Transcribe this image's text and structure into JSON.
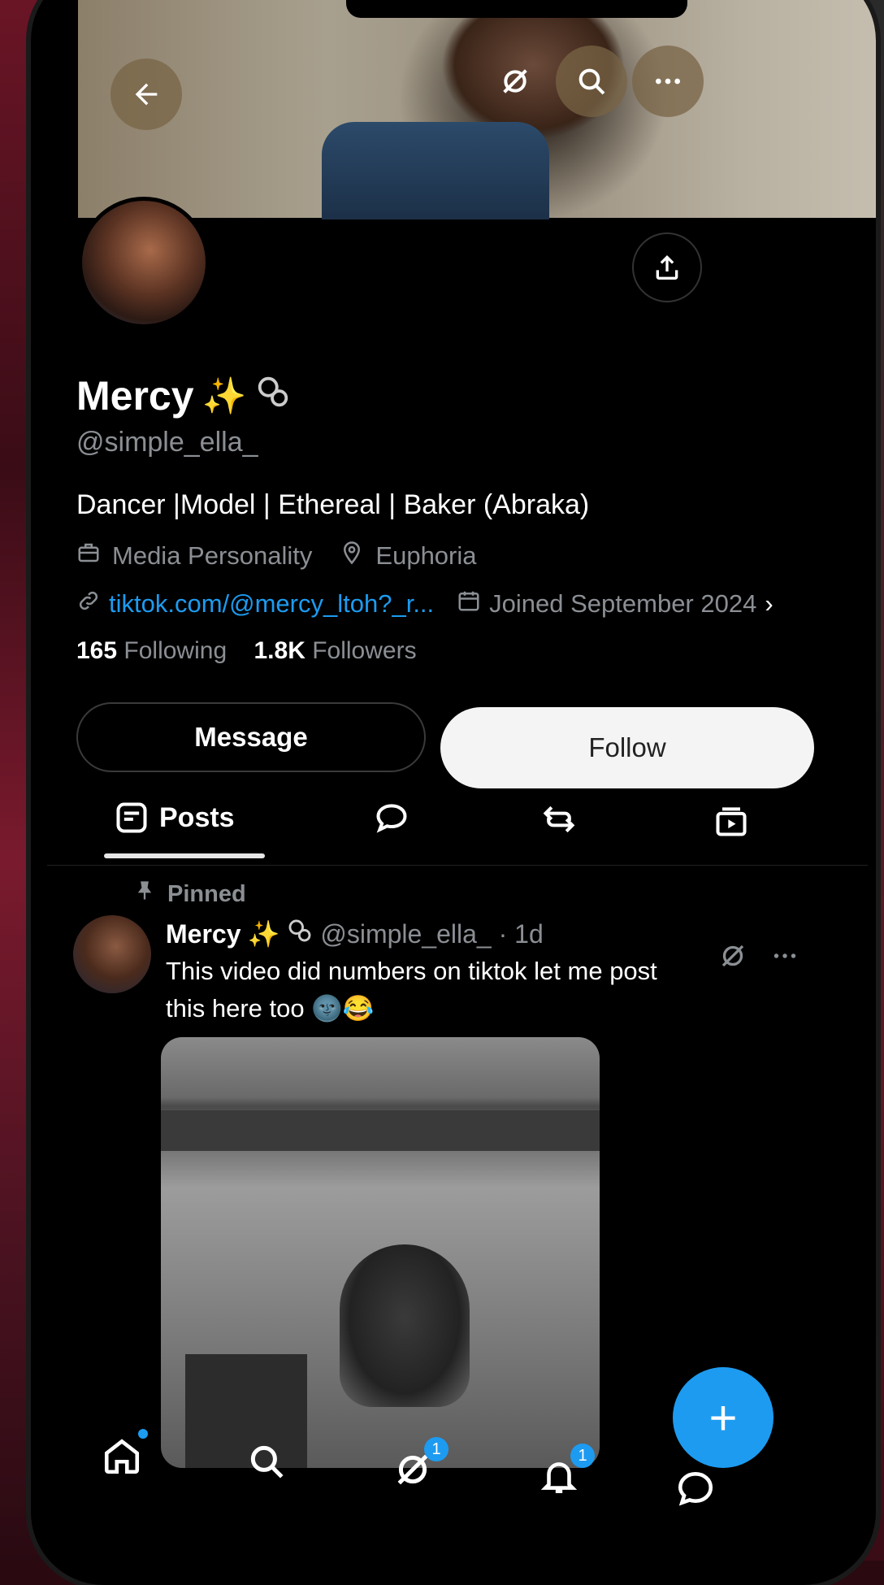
{
  "profile": {
    "display_name": "Mercy",
    "emoji": "✨",
    "handle": "@simple_ella_",
    "bio": "Dancer |Model | Ethereal | Baker (Abraka)",
    "category": "Media Personality",
    "location": "Euphoria",
    "website": "tiktok.com/@mercy_ltoh?_r...",
    "joined": "Joined September 2024",
    "following_count": "165",
    "following_label": "Following",
    "followers_count": "1.8K",
    "followers_label": "Followers"
  },
  "actions": {
    "message_label": "Message",
    "follow_label": "Follow"
  },
  "tabs": {
    "posts_label": "Posts"
  },
  "post": {
    "pinned_label": "Pinned",
    "author": "Mercy",
    "emoji": "✨",
    "handle_time": "@simple_ella_ · 1d",
    "text": "This video did numbers on tiktok let me post this here too 🌚😂"
  },
  "nav": {
    "notifications_badge": "1",
    "grok_badge": "1"
  },
  "fab_label": "+"
}
